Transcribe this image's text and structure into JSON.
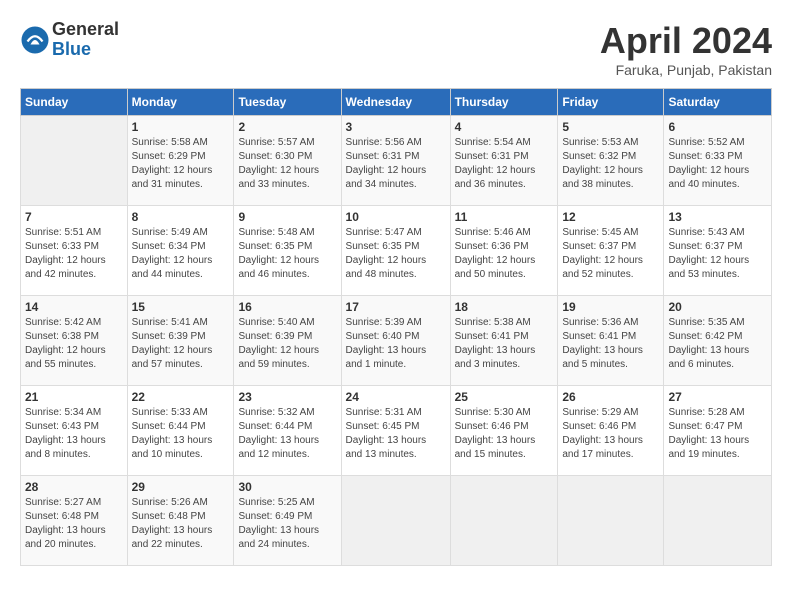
{
  "logo": {
    "general": "General",
    "blue": "Blue"
  },
  "title": "April 2024",
  "subtitle": "Faruka, Punjab, Pakistan",
  "days_header": [
    "Sunday",
    "Monday",
    "Tuesday",
    "Wednesday",
    "Thursday",
    "Friday",
    "Saturday"
  ],
  "weeks": [
    [
      {
        "day": "",
        "info": ""
      },
      {
        "day": "1",
        "info": "Sunrise: 5:58 AM\nSunset: 6:29 PM\nDaylight: 12 hours\nand 31 minutes."
      },
      {
        "day": "2",
        "info": "Sunrise: 5:57 AM\nSunset: 6:30 PM\nDaylight: 12 hours\nand 33 minutes."
      },
      {
        "day": "3",
        "info": "Sunrise: 5:56 AM\nSunset: 6:31 PM\nDaylight: 12 hours\nand 34 minutes."
      },
      {
        "day": "4",
        "info": "Sunrise: 5:54 AM\nSunset: 6:31 PM\nDaylight: 12 hours\nand 36 minutes."
      },
      {
        "day": "5",
        "info": "Sunrise: 5:53 AM\nSunset: 6:32 PM\nDaylight: 12 hours\nand 38 minutes."
      },
      {
        "day": "6",
        "info": "Sunrise: 5:52 AM\nSunset: 6:33 PM\nDaylight: 12 hours\nand 40 minutes."
      }
    ],
    [
      {
        "day": "7",
        "info": "Sunrise: 5:51 AM\nSunset: 6:33 PM\nDaylight: 12 hours\nand 42 minutes."
      },
      {
        "day": "8",
        "info": "Sunrise: 5:49 AM\nSunset: 6:34 PM\nDaylight: 12 hours\nand 44 minutes."
      },
      {
        "day": "9",
        "info": "Sunrise: 5:48 AM\nSunset: 6:35 PM\nDaylight: 12 hours\nand 46 minutes."
      },
      {
        "day": "10",
        "info": "Sunrise: 5:47 AM\nSunset: 6:35 PM\nDaylight: 12 hours\nand 48 minutes."
      },
      {
        "day": "11",
        "info": "Sunrise: 5:46 AM\nSunset: 6:36 PM\nDaylight: 12 hours\nand 50 minutes."
      },
      {
        "day": "12",
        "info": "Sunrise: 5:45 AM\nSunset: 6:37 PM\nDaylight: 12 hours\nand 52 minutes."
      },
      {
        "day": "13",
        "info": "Sunrise: 5:43 AM\nSunset: 6:37 PM\nDaylight: 12 hours\nand 53 minutes."
      }
    ],
    [
      {
        "day": "14",
        "info": "Sunrise: 5:42 AM\nSunset: 6:38 PM\nDaylight: 12 hours\nand 55 minutes."
      },
      {
        "day": "15",
        "info": "Sunrise: 5:41 AM\nSunset: 6:39 PM\nDaylight: 12 hours\nand 57 minutes."
      },
      {
        "day": "16",
        "info": "Sunrise: 5:40 AM\nSunset: 6:39 PM\nDaylight: 12 hours\nand 59 minutes."
      },
      {
        "day": "17",
        "info": "Sunrise: 5:39 AM\nSunset: 6:40 PM\nDaylight: 13 hours\nand 1 minute."
      },
      {
        "day": "18",
        "info": "Sunrise: 5:38 AM\nSunset: 6:41 PM\nDaylight: 13 hours\nand 3 minutes."
      },
      {
        "day": "19",
        "info": "Sunrise: 5:36 AM\nSunset: 6:41 PM\nDaylight: 13 hours\nand 5 minutes."
      },
      {
        "day": "20",
        "info": "Sunrise: 5:35 AM\nSunset: 6:42 PM\nDaylight: 13 hours\nand 6 minutes."
      }
    ],
    [
      {
        "day": "21",
        "info": "Sunrise: 5:34 AM\nSunset: 6:43 PM\nDaylight: 13 hours\nand 8 minutes."
      },
      {
        "day": "22",
        "info": "Sunrise: 5:33 AM\nSunset: 6:44 PM\nDaylight: 13 hours\nand 10 minutes."
      },
      {
        "day": "23",
        "info": "Sunrise: 5:32 AM\nSunset: 6:44 PM\nDaylight: 13 hours\nand 12 minutes."
      },
      {
        "day": "24",
        "info": "Sunrise: 5:31 AM\nSunset: 6:45 PM\nDaylight: 13 hours\nand 13 minutes."
      },
      {
        "day": "25",
        "info": "Sunrise: 5:30 AM\nSunset: 6:46 PM\nDaylight: 13 hours\nand 15 minutes."
      },
      {
        "day": "26",
        "info": "Sunrise: 5:29 AM\nSunset: 6:46 PM\nDaylight: 13 hours\nand 17 minutes."
      },
      {
        "day": "27",
        "info": "Sunrise: 5:28 AM\nSunset: 6:47 PM\nDaylight: 13 hours\nand 19 minutes."
      }
    ],
    [
      {
        "day": "28",
        "info": "Sunrise: 5:27 AM\nSunset: 6:48 PM\nDaylight: 13 hours\nand 20 minutes."
      },
      {
        "day": "29",
        "info": "Sunrise: 5:26 AM\nSunset: 6:48 PM\nDaylight: 13 hours\nand 22 minutes."
      },
      {
        "day": "30",
        "info": "Sunrise: 5:25 AM\nSunset: 6:49 PM\nDaylight: 13 hours\nand 24 minutes."
      },
      {
        "day": "",
        "info": ""
      },
      {
        "day": "",
        "info": ""
      },
      {
        "day": "",
        "info": ""
      },
      {
        "day": "",
        "info": ""
      }
    ]
  ]
}
